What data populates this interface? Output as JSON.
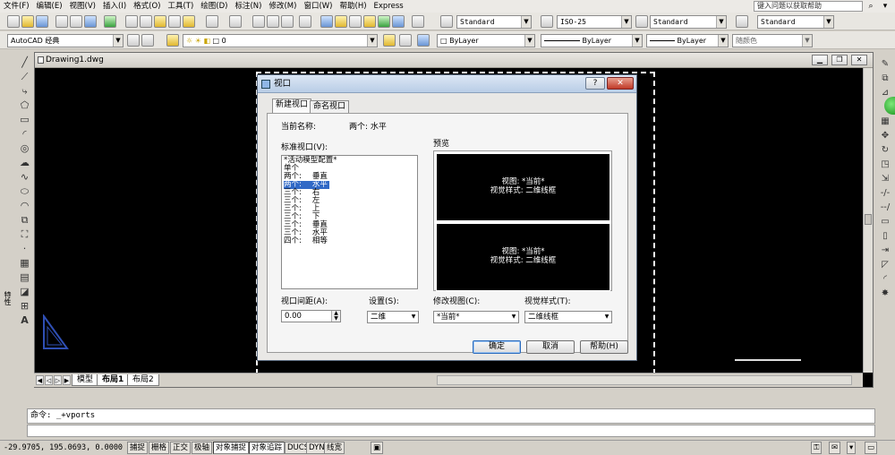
{
  "menubar": {
    "items": [
      "文件(F)",
      "编辑(E)",
      "视图(V)",
      "插入(I)",
      "格式(O)",
      "工具(T)",
      "绘图(D)",
      "标注(N)",
      "修改(M)",
      "窗口(W)",
      "帮助(H)",
      "Express"
    ],
    "help_search_placeholder": "键入问题以获取帮助"
  },
  "toolbar1": {
    "text_style": "Standard",
    "dim_style": "ISO-25",
    "table_style": "Standard",
    "mleader_style": "Standard"
  },
  "toolbar2": {
    "workspace": "AutoCAD 经典",
    "layer": "0",
    "color": "ByLayer",
    "linetype": "ByLayer",
    "lineweight": "ByLayer",
    "plotstyle": "随颜色"
  },
  "left_palette": {
    "vertical_label": "特性"
  },
  "drawing_window": {
    "title": "Drawing1.dwg"
  },
  "layout_tabs": [
    "模型",
    "布局1",
    "布局2"
  ],
  "command": {
    "line1": "命令: _+vports"
  },
  "status": {
    "coords": "-29.9705, 195.0693, 0.0000",
    "buttons": [
      "捕捉",
      "栅格",
      "正交",
      "极轴",
      "对象捕捉",
      "对象追踪",
      "DUCS",
      "DYN",
      "线宽"
    ]
  },
  "dialog": {
    "title": "视口",
    "tabs": [
      "新建视口",
      "命名视口"
    ],
    "current_name_label": "当前名称:",
    "current_name_value": "两个: 水平",
    "standard_label": "标准视口(V):",
    "standard_list": [
      {
        "left": "*活动模型配置*",
        "right": ""
      },
      {
        "left": "单个",
        "right": ""
      },
      {
        "left": "两个:",
        "right": "垂直"
      },
      {
        "left": "两个:",
        "right": "水平"
      },
      {
        "left": "三个:",
        "right": "右"
      },
      {
        "left": "三个:",
        "right": "左"
      },
      {
        "left": "三个:",
        "right": "上"
      },
      {
        "left": "三个:",
        "right": "下"
      },
      {
        "left": "三个:",
        "right": "垂直"
      },
      {
        "left": "三个:",
        "right": "水平"
      },
      {
        "left": "四个:",
        "right": "相等"
      }
    ],
    "selected_index": 3,
    "preview_label": "预览",
    "preview_top": {
      "view": "视图: *当前*",
      "style": "视觉样式: 二维线框"
    },
    "preview_bottom": {
      "view": "视图: *当前*",
      "style": "视觉样式: 二维线框"
    },
    "spacing_label": "视口间距(A):",
    "spacing_value": "0.00",
    "setup_label": "设置(S):",
    "setup_value": "二维",
    "change_view_label": "修改视图(C):",
    "change_view_value": "*当前*",
    "visual_style_label": "视觉样式(T):",
    "visual_style_value": "二维线框",
    "ok": "确定",
    "cancel": "取消",
    "help": "帮助(H)",
    "help_q": "?",
    "close_x": "✕"
  }
}
